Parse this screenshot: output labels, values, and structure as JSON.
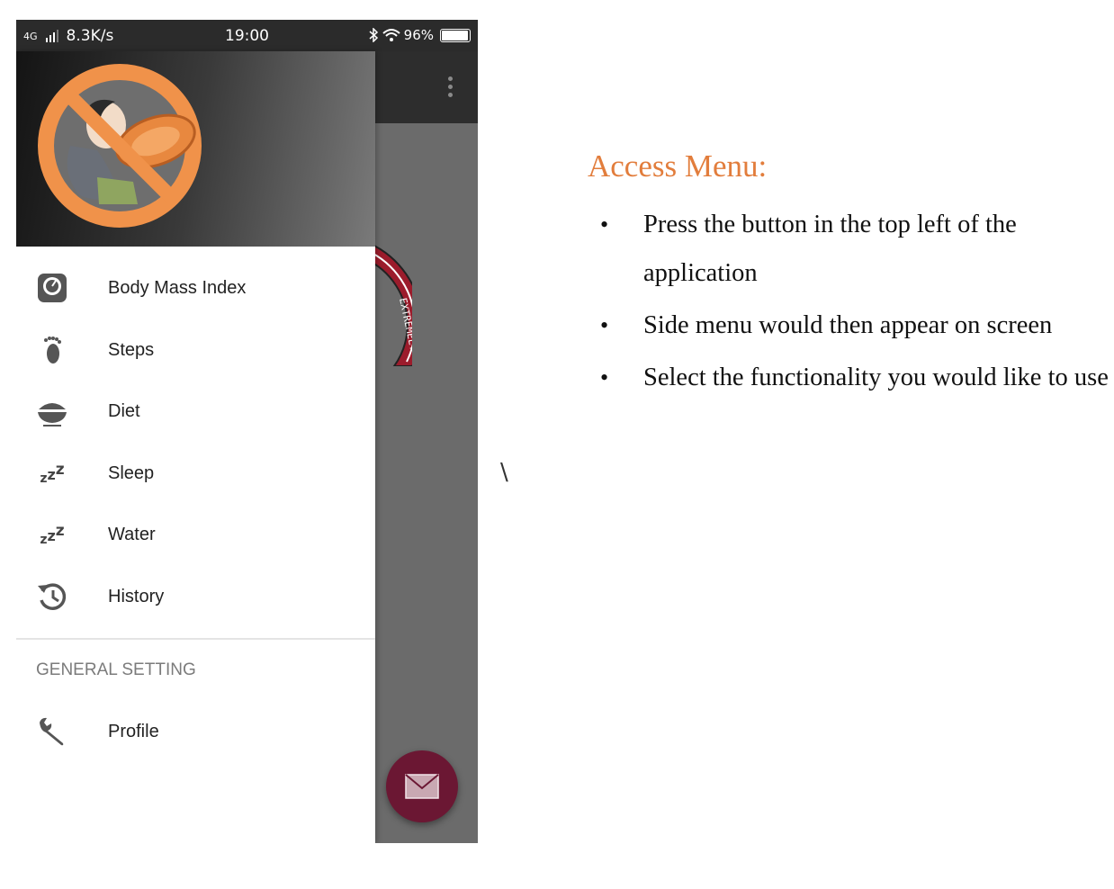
{
  "status_bar": {
    "network": "4G",
    "speed": "8.3K/s",
    "time": "19:00",
    "battery": "96%"
  },
  "app_bar": {
    "overflow_icon": "more-vert-icon"
  },
  "background": {
    "gauge_text": "EXTREMELY OBESE"
  },
  "drawer": {
    "items": [
      {
        "label": "Body Mass Index",
        "icon": "scale-icon"
      },
      {
        "label": "Steps",
        "icon": "footprint-icon"
      },
      {
        "label": "Diet",
        "icon": "food-bowl-icon"
      },
      {
        "label": "Sleep",
        "icon": "sleep-zzz-icon"
      },
      {
        "label": "Water",
        "icon": "water-zzz-icon"
      },
      {
        "label": "History",
        "icon": "history-icon"
      }
    ],
    "section_title": "GENERAL SETTING",
    "settings_items": [
      {
        "label": "Profile",
        "icon": "wrench-icon"
      }
    ]
  },
  "fab": {
    "icon": "mail-icon"
  },
  "stray_mark": "\\",
  "instructions": {
    "heading": "Access Menu:",
    "bullets": [
      "Press the button in the top left of the application",
      "Side menu would then appear on screen",
      "Select the functionality you would like to use"
    ]
  },
  "colors": {
    "heading": "#e27d3c",
    "fab": "#6b1733",
    "logo_ring": "#f0924a",
    "app_bar": "#2d2d2d"
  }
}
